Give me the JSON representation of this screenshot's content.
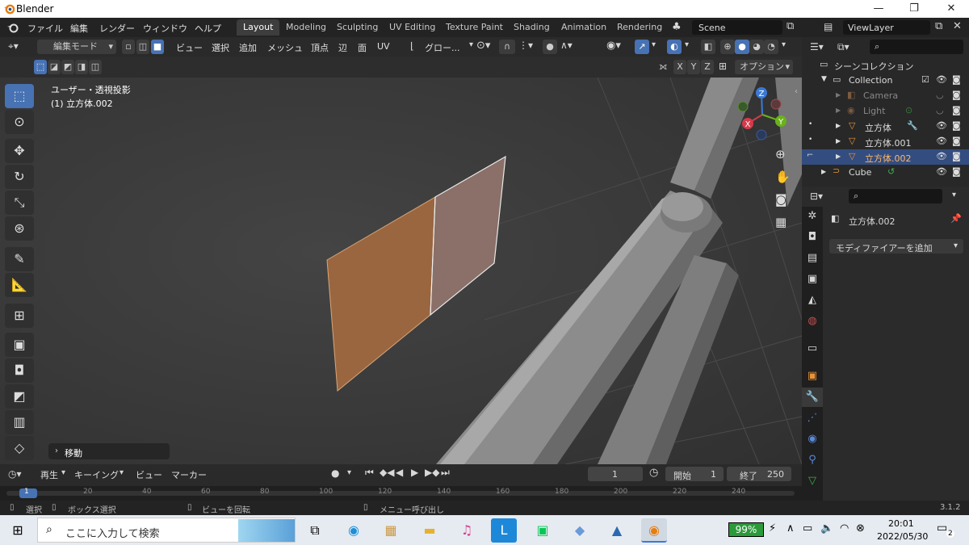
{
  "window": {
    "title": "Blender",
    "min": "—",
    "max": "❐",
    "close": "✕"
  },
  "menubar": {
    "items": [
      "ファイル",
      "編集",
      "レンダー",
      "ウィンドウ",
      "ヘルプ"
    ],
    "workspaces": [
      "Layout",
      "Modeling",
      "Sculpting",
      "UV Editing",
      "Texture Paint",
      "Shading",
      "Animation",
      "Rendering"
    ],
    "scene": "Scene",
    "view_layer": "ViewLayer"
  },
  "viewport_header": {
    "mode": "編集モード",
    "menus": [
      "ビュー",
      "選択",
      "追加",
      "メッシュ",
      "頂点",
      "辺",
      "面",
      "UV"
    ],
    "transform_orientation": "グロー...",
    "axes": [
      "X",
      "Y",
      "Z"
    ],
    "options": "オプション"
  },
  "viewport": {
    "view_name": "ユーザー・透視投影",
    "object_name": "(1) 立方体.002",
    "last_op": "移動",
    "gizmo_axes": {
      "x": "X",
      "y": "Y",
      "z": "Z"
    }
  },
  "outliner": {
    "root": "シーンコレクション",
    "collection": "Collection",
    "items": [
      {
        "name": "Camera",
        "dim": true
      },
      {
        "name": "Light",
        "dim": true
      },
      {
        "name": "立方体",
        "dim": false
      },
      {
        "name": "立方体.001",
        "dim": false
      },
      {
        "name": "立方体.002",
        "dim": false,
        "selected": true
      },
      {
        "name": "Cube",
        "dim": false
      }
    ]
  },
  "properties": {
    "object_name": "立方体.002",
    "add_modifier": "モディファイアーを追加"
  },
  "timeline": {
    "menus": [
      "再生",
      "キーイング",
      "ビュー",
      "マーカー"
    ],
    "current_frame": "1",
    "start_label": "開始",
    "start": "1",
    "end_label": "終了",
    "end": "250",
    "ruler": [
      "1",
      "20",
      "40",
      "60",
      "80",
      "100",
      "120",
      "140",
      "160",
      "180",
      "200",
      "220",
      "240"
    ]
  },
  "statusbar": {
    "select": "選択",
    "box_select": "ボックス選択",
    "rotate_view": "ビューを回転",
    "call_menu": "メニュー呼び出し",
    "version": "3.1.2"
  },
  "taskbar": {
    "search_placeholder": "ここに入力して検索",
    "battery": "99%",
    "time": "20:01",
    "date": "2022/05/30",
    "notifications": "2"
  },
  "colors": {
    "accent": "#4772b3",
    "selected_row": "#334d80",
    "face_orange": "#9a6640",
    "object_orange": "#e8933a"
  }
}
